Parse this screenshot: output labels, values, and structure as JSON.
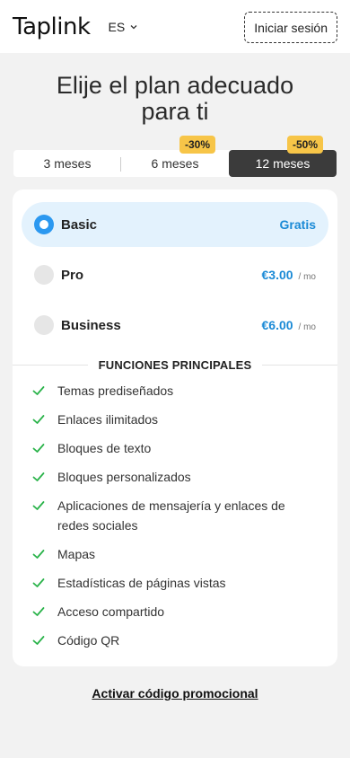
{
  "header": {
    "logo": "Taplink",
    "language": "ES",
    "login_label": "Iniciar sesión"
  },
  "title": "Elije el plan adecuado para ti",
  "periods": [
    {
      "label": "3 meses",
      "badge": null,
      "active": false
    },
    {
      "label": "6 meses",
      "badge": "-30%",
      "active": false
    },
    {
      "label": "12 meses",
      "badge": "-50%",
      "active": true
    }
  ],
  "plans": [
    {
      "name": "Basic",
      "price": "Gratis",
      "per": "",
      "selected": true
    },
    {
      "name": "Pro",
      "price": "€3.00",
      "per": "/ mo",
      "selected": false
    },
    {
      "name": "Business",
      "price": "€6.00",
      "per": "/ mo",
      "selected": false
    }
  ],
  "features_title": "FUNCIONES PRINCIPALES",
  "features": [
    "Temas prediseñados",
    "Enlaces ilimitados",
    "Bloques de texto",
    "Bloques personalizados",
    "Aplicaciones de mensajería y enlaces de redes sociales",
    "Mapas",
    "Estadísticas de páginas vistas",
    "Acceso compartido",
    "Código QR"
  ],
  "promo_label": "Activar código promocional",
  "colors": {
    "accent": "#1a8ad6",
    "radio_selected": "#2b98f0",
    "selected_bg": "#e3f2fd",
    "badge": "#f7c548",
    "check": "#2ab34a",
    "active_period": "#3b3b3b"
  }
}
